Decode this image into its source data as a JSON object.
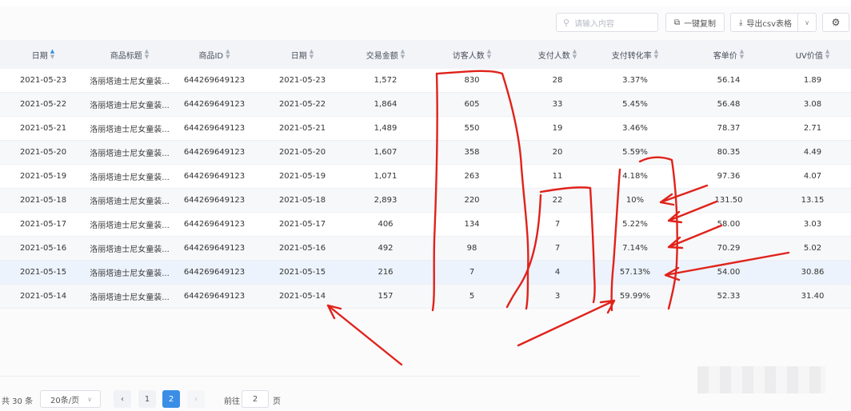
{
  "toolbar": {
    "search_placeholder": "请输入内容",
    "copy_label": "一键复制",
    "export_label": "导出csv表格"
  },
  "columns": [
    {
      "label": "日期",
      "sort_active": true
    },
    {
      "label": "商品标题"
    },
    {
      "label": "商品ID"
    },
    {
      "label": "日期"
    },
    {
      "label": "交易金额"
    },
    {
      "label": "访客人数"
    },
    {
      "label": "支付人数"
    },
    {
      "label": "支付转化率"
    },
    {
      "label": "客单价"
    },
    {
      "label": "UV价值"
    }
  ],
  "rows": [
    [
      "2021-05-23",
      "洛丽塔迪士尼女童装...",
      "644269649123",
      "2021-05-23",
      "1,572",
      "830",
      "28",
      "3.37%",
      "56.14",
      "1.89"
    ],
    [
      "2021-05-22",
      "洛丽塔迪士尼女童装...",
      "644269649123",
      "2021-05-22",
      "1,864",
      "605",
      "33",
      "5.45%",
      "56.48",
      "3.08"
    ],
    [
      "2021-05-21",
      "洛丽塔迪士尼女童装...",
      "644269649123",
      "2021-05-21",
      "1,489",
      "550",
      "19",
      "3.46%",
      "78.37",
      "2.71"
    ],
    [
      "2021-05-20",
      "洛丽塔迪士尼女童装...",
      "644269649123",
      "2021-05-20",
      "1,607",
      "358",
      "20",
      "5.59%",
      "80.35",
      "4.49"
    ],
    [
      "2021-05-19",
      "洛丽塔迪士尼女童装...",
      "644269649123",
      "2021-05-19",
      "1,071",
      "263",
      "11",
      "4.18%",
      "97.36",
      "4.07"
    ],
    [
      "2021-05-18",
      "洛丽塔迪士尼女童装...",
      "644269649123",
      "2021-05-18",
      "2,893",
      "220",
      "22",
      "10%",
      "131.50",
      "13.15"
    ],
    [
      "2021-05-17",
      "洛丽塔迪士尼女童装...",
      "644269649123",
      "2021-05-17",
      "406",
      "134",
      "7",
      "5.22%",
      "58.00",
      "3.03"
    ],
    [
      "2021-05-16",
      "洛丽塔迪士尼女童装...",
      "644269649123",
      "2021-05-16",
      "492",
      "98",
      "7",
      "7.14%",
      "70.29",
      "5.02"
    ],
    [
      "2021-05-15",
      "洛丽塔迪士尼女童装...",
      "644269649123",
      "2021-05-15",
      "216",
      "7",
      "4",
      "57.13%",
      "54.00",
      "30.86"
    ],
    [
      "2021-05-14",
      "洛丽塔迪士尼女童装...",
      "644269649123",
      "2021-05-14",
      "157",
      "5",
      "3",
      "59.99%",
      "52.33",
      "31.40"
    ]
  ],
  "pagination": {
    "total": "共 30 条",
    "page_size": "20条/页",
    "pages": [
      "1",
      "2"
    ],
    "current": "2",
    "goto_label": "前往",
    "goto_value": "2",
    "page_unit": "页"
  },
  "annotation_color": "#e0221b"
}
